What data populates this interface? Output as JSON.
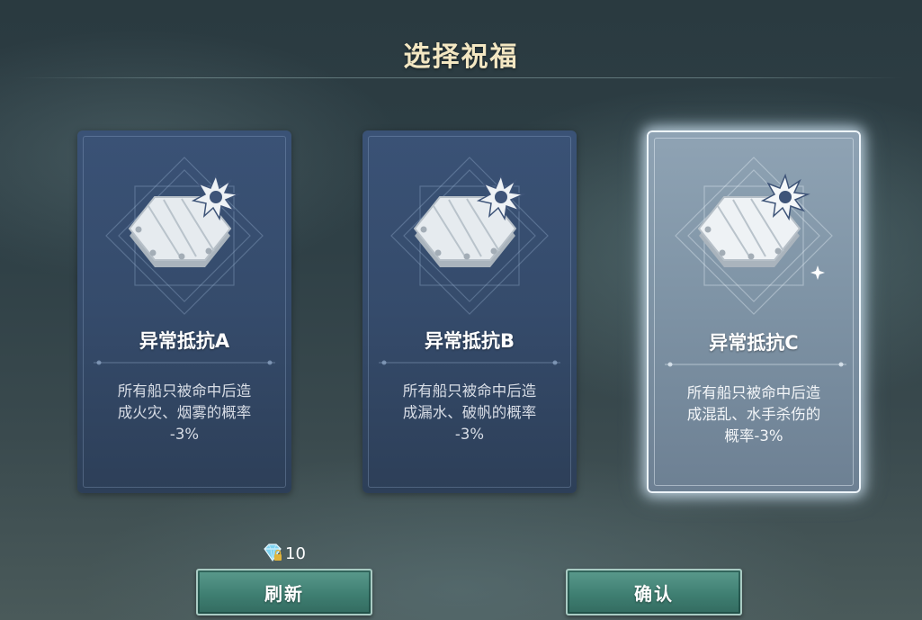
{
  "header": {
    "title": "选择祝福"
  },
  "cards": [
    {
      "name": "异常抵抗A",
      "desc_lines": [
        "所有船只被命中后造",
        "成火灾、烟雾的概率",
        "-3%"
      ],
      "selected": false
    },
    {
      "name": "异常抵抗B",
      "desc_lines": [
        "所有船只被命中后造",
        "成漏水、破帆的概率",
        "-3%"
      ],
      "selected": false
    },
    {
      "name": "异常抵抗C",
      "desc_lines": [
        "所有船只被命中后造",
        "成混乱、水手杀伤的",
        "概率-3%"
      ],
      "selected": true
    }
  ],
  "refresh": {
    "cost_icon": "diamond-icon",
    "cost": "10",
    "label": "刷新"
  },
  "confirm": {
    "label": "确认"
  },
  "colors": {
    "title": "#f3e7c2",
    "card": "#354b6b",
    "button": "#3f7f72"
  }
}
